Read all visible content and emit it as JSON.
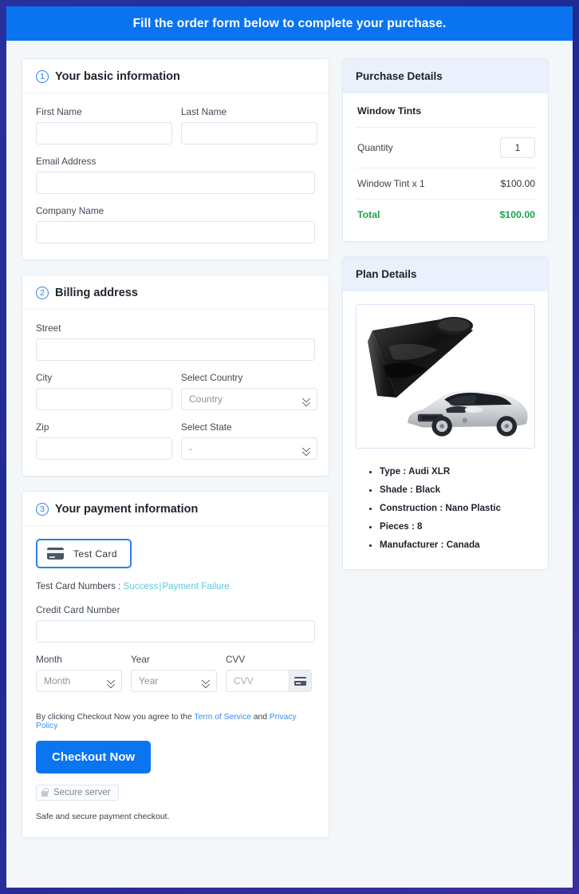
{
  "banner": {
    "text": "Fill the order form below to complete your purchase."
  },
  "sections": {
    "basic": {
      "step": "1",
      "title": "Your basic information",
      "fields": {
        "first_name_label": "First Name",
        "first_name_value": "",
        "last_name_label": "Last Name",
        "last_name_value": "",
        "email_label": "Email Address",
        "email_value": "",
        "company_label": "Company Name",
        "company_value": ""
      }
    },
    "billing": {
      "step": "2",
      "title": "Billing address",
      "fields": {
        "street_label": "Street",
        "street_value": "",
        "city_label": "City",
        "city_value": "",
        "country_label": "Select Country",
        "country_placeholder": "Country",
        "zip_label": "Zip",
        "zip_value": "",
        "state_label": "Select State",
        "state_placeholder": "-"
      }
    },
    "payment": {
      "step": "3",
      "title": "Your payment information",
      "card_tab_label": "Test  Card",
      "test_card_prefix": "Test Card Numbers : ",
      "test_card_success": "Success",
      "test_card_sep": "|",
      "test_card_failure": "Payment Failure",
      "cc_label": "Credit Card Number",
      "cc_value": "",
      "month_label": "Month",
      "month_placeholder": "Month",
      "year_label": "Year",
      "year_placeholder": "Year",
      "cvv_label": "CVV",
      "cvv_placeholder": "CVV",
      "terms_prefix": "By clicking Checkout Now you agree to the ",
      "terms_link1": "Term of Service",
      "terms_mid": " and ",
      "terms_link2": "Privacy Policy",
      "checkout_label": "Checkout Now",
      "secure_label": "Secure server",
      "safe_text": "Safe and secure payment checkout."
    }
  },
  "purchase_details": {
    "title": "Purchase Details",
    "product": "Window Tints",
    "quantity_label": "Quantity",
    "quantity_value": "1",
    "line_item_label": "Window Tint x 1",
    "line_item_value": "$100.00",
    "total_label": "Total",
    "total_value": "$100.00"
  },
  "plan_details": {
    "title": "Plan Details",
    "specs": [
      "Type : Audi XLR",
      "Shade : Black",
      "Construction : Nano Plastic",
      "Pieces : 8",
      "Manufacturer : Canada"
    ]
  },
  "colors": {
    "accent_blue": "#0a74f0",
    "total_green": "#19a84a",
    "link_teal": "#5bc9d8",
    "link_blue": "#3d8bf2",
    "panel_head_bg": "#eaf1fd",
    "page_bg": "#f4f7fa",
    "outer_bg": "#222a8c"
  }
}
